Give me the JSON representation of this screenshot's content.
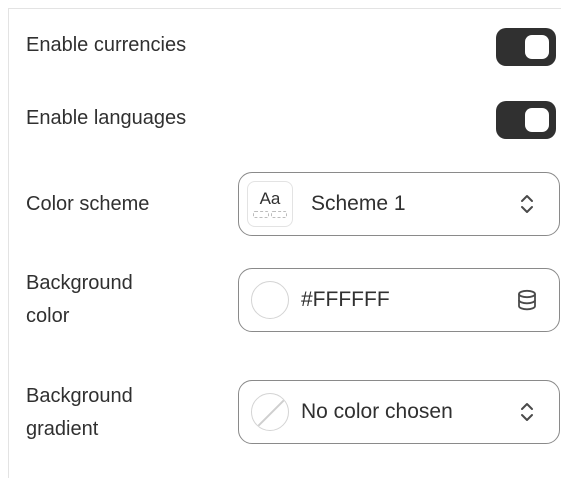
{
  "settings": {
    "enable_currencies": {
      "label": "Enable currencies",
      "enabled": true
    },
    "enable_languages": {
      "label": "Enable languages",
      "enabled": true
    },
    "color_scheme": {
      "label": "Color scheme",
      "badge_text": "Aa",
      "value": "Scheme 1",
      "icon": "chevron-up-down-icon"
    },
    "background_color": {
      "label_line1": "Background",
      "label_line2": "color",
      "value": "#FFFFFF",
      "icon": "database-icon"
    },
    "background_gradient": {
      "label_line1": "Background",
      "label_line2": "gradient",
      "value": "No color chosen",
      "icon": "chevron-up-down-icon"
    }
  },
  "colors": {
    "toggle_on": "#303030",
    "text": "#303030",
    "field_border": "#8a8a8a"
  }
}
